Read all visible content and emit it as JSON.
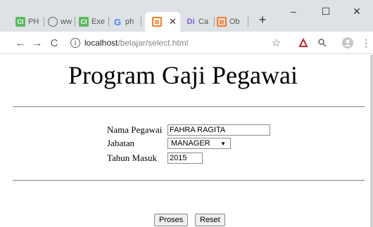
{
  "tabs": [
    {
      "label": "PH",
      "icon": "ci-icon",
      "color": "#5cb85c"
    },
    {
      "label": "ww",
      "icon": "globe-icon",
      "color": "#5f6368"
    },
    {
      "label": "Exe",
      "icon": "ci-icon",
      "color": "#5cb85c"
    },
    {
      "label": "ph",
      "icon": "google-icon",
      "color": "#4285f4"
    },
    {
      "label": "",
      "icon": "xampp-icon",
      "color": "#fb7a24",
      "active": true
    },
    {
      "label": "Ca",
      "icon": "di-icon",
      "color": "#7b5bdb"
    },
    {
      "label": "Ob",
      "icon": "xampp-icon",
      "color": "#fb7a24"
    }
  ],
  "toolbar": {
    "url_host": "localhost",
    "url_path": "/belajar/select.html"
  },
  "page": {
    "title": "Program Gaji Pegawai",
    "form": {
      "nama_label": "Nama Pegawai",
      "nama_value": "FAHRA RAGITA",
      "jabatan_label": "Jabatan",
      "jabatan_value": "MANAGER",
      "tahun_label": "Tahun Masuk",
      "tahun_value": "2015"
    },
    "buttons": {
      "proses": "Proses",
      "reset": "Reset"
    }
  }
}
